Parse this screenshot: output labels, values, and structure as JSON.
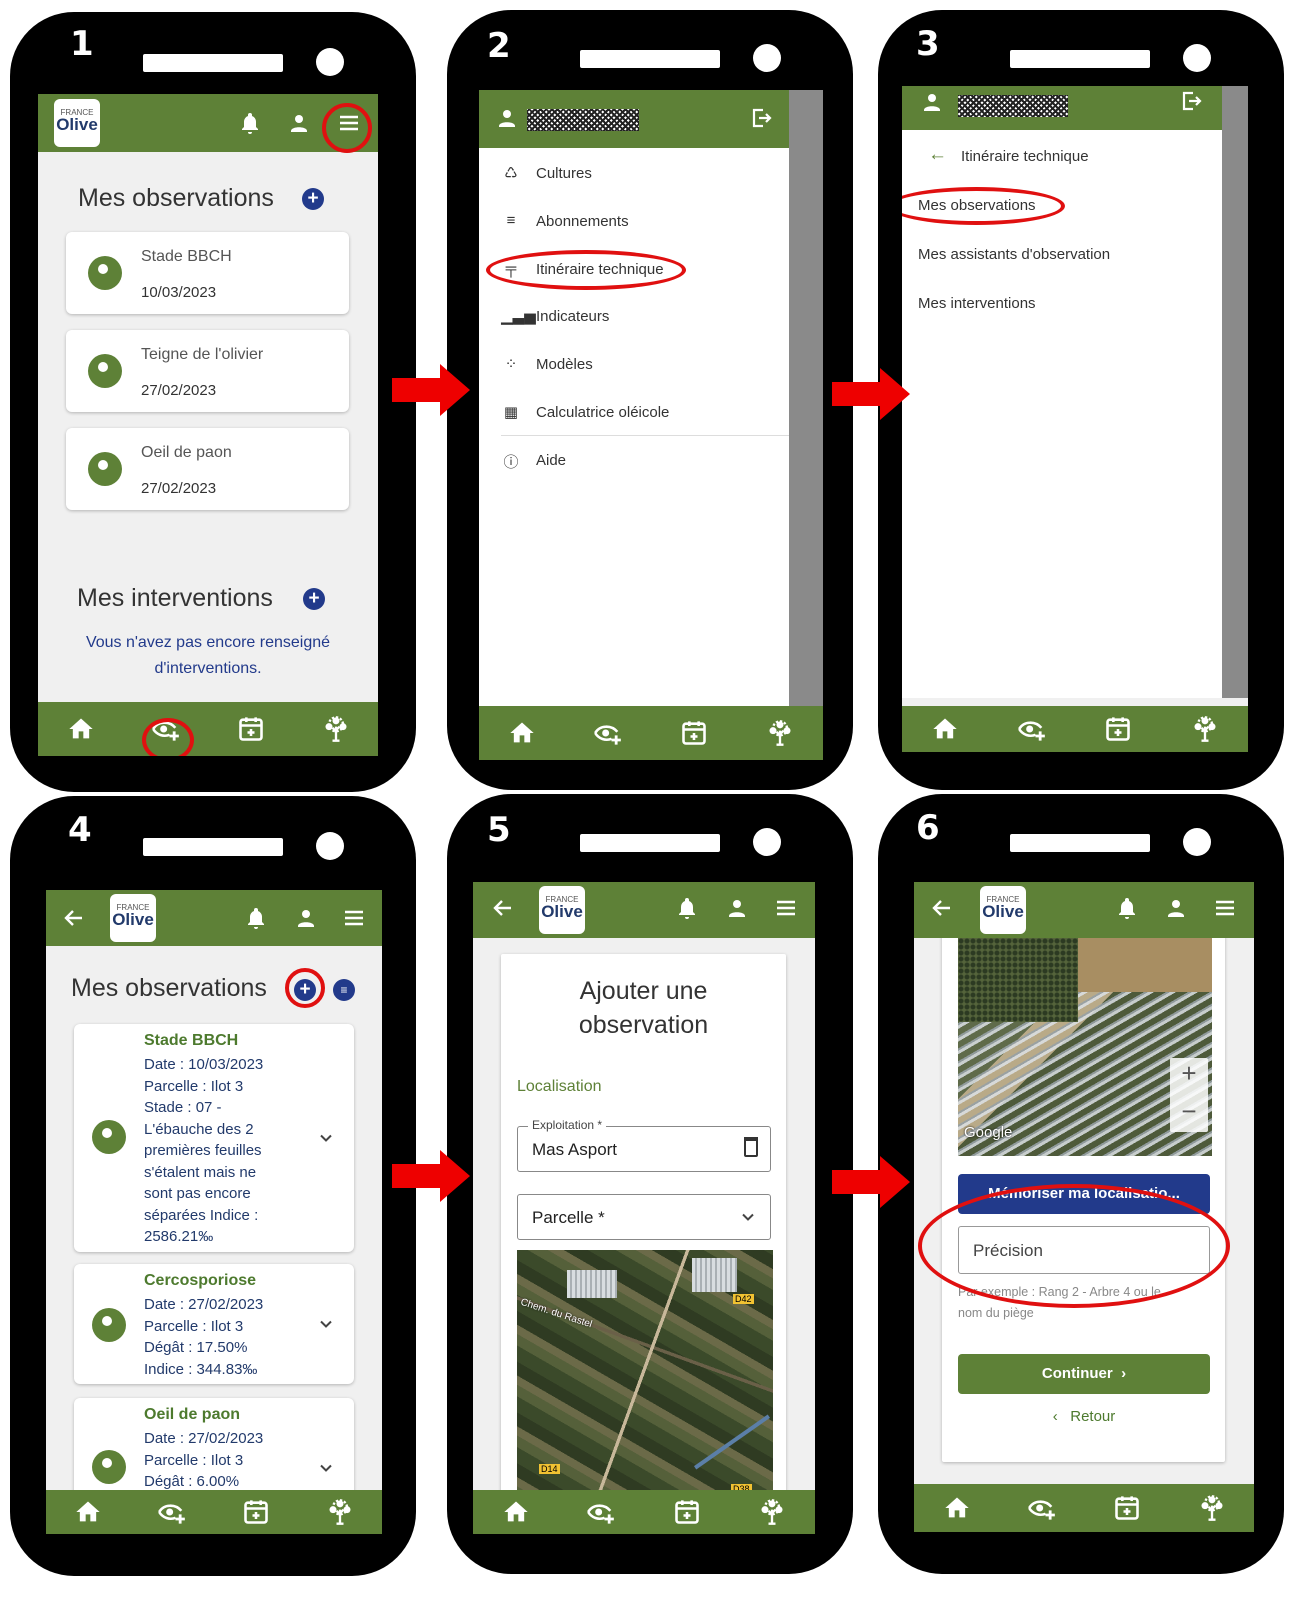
{
  "steps": [
    "1",
    "2",
    "3",
    "4",
    "5",
    "6"
  ],
  "brand": {
    "top": "FRANCE",
    "name": "Olive"
  },
  "icons": {
    "bell": "bell-icon",
    "user": "user-icon",
    "menu": "menu-icon",
    "back": "arrow-left-icon",
    "home": "home-icon",
    "eye_plus": "eye-plus-icon",
    "calendar_plus": "calendar-plus-icon",
    "tree": "tree-icon",
    "logout": "logout-icon",
    "filter": "filter-icon",
    "trash": "trash-icon",
    "chevron_down": "chevron-down-icon"
  },
  "colors": {
    "green": "#5e8137",
    "navy": "#223a8b",
    "red_highlight": "#e01010",
    "dark_green_text": "#4d7a2e"
  },
  "s1": {
    "obs_title": "Mes observations",
    "cards": [
      {
        "name": "Stade BBCH",
        "date": "10/03/2023"
      },
      {
        "name": "Teigne de l'olivier",
        "date": "27/02/2023"
      },
      {
        "name": "Oeil de paon",
        "date": "27/02/2023"
      }
    ],
    "int_title": "Mes interventions",
    "empty_line1": "Vous n'avez pas encore renseigné",
    "empty_line2": "d'interventions."
  },
  "s2": {
    "menu": [
      "Cultures",
      "Abonnements",
      "Itinéraire technique",
      "Indicateurs",
      "Modèles",
      "Calculatrice oléicole",
      "Aide"
    ]
  },
  "s3": {
    "back_label": "Itinéraire technique",
    "items": [
      "Mes observations",
      "Mes assistants d'observation",
      "Mes interventions"
    ]
  },
  "s4": {
    "title": "Mes observations",
    "cards": [
      {
        "name": "Stade BBCH",
        "lines": [
          "Date : 10/03/2023",
          "Parcelle : Ilot 3",
          "Stade : 07 -",
          "L'ébauche des 2",
          "premières feuilles",
          "s'étalent mais ne",
          "sont pas encore",
          "séparées Indice :",
          "2586.21‰"
        ]
      },
      {
        "name": "Cercosporiose",
        "lines": [
          "Date : 27/02/2023",
          "Parcelle : Ilot 3",
          "Dégât : 17.50%",
          "Indice : 344.83‰"
        ]
      },
      {
        "name": "Oeil de paon",
        "lines": [
          "Date : 27/02/2023",
          "Parcelle : Ilot 3",
          "Dégât : 6.00%"
        ]
      }
    ]
  },
  "s5": {
    "heading1": "Ajouter une",
    "heading2": "observation",
    "section": "Localisation",
    "exploitation_label": "Exploitation *",
    "exploitation_value": "Mas Asport",
    "parcelle_label": "Parcelle *",
    "map_labels": [
      "Chem. du Rastel",
      "D42",
      "D14",
      "D38"
    ]
  },
  "s6": {
    "map_brand": "Google",
    "zoom_in": "+",
    "zoom_out": "−",
    "memorize_button": "Mémoriser ma localisatio...",
    "precision_placeholder": "Précision",
    "hint_line1": "Par exemple : Rang 2 - Arbre 4 ou le",
    "hint_line2": "nom du piège",
    "continue_button": "Continuer",
    "continue_chevron": "›",
    "back_chevron": "‹",
    "back_button": "Retour"
  }
}
